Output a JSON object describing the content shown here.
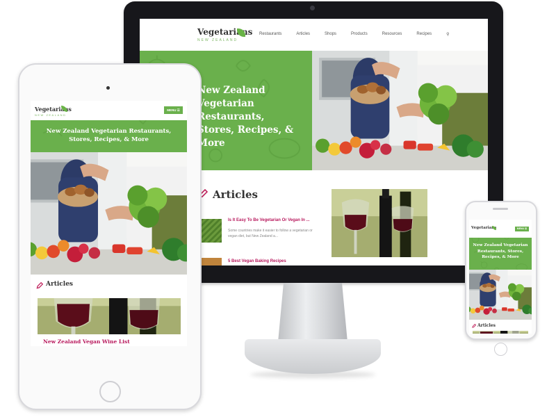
{
  "site": {
    "logo_name": "Vegetarians",
    "logo_sub": "NEW ZEALAND",
    "nav": [
      "Restaurants",
      "Articles",
      "Shops",
      "Products",
      "Resources",
      "Recipes"
    ],
    "menu_button": "MENU ☰"
  },
  "desktop": {
    "hero_title": "New Zealand Vegetarian Restaurants, Stores, Recipes, & More",
    "articles_heading": "Articles",
    "posts": [
      {
        "title": "Is It Easy To Be Vegetarian Or Vegan In ...",
        "excerpt": "Some countries make it easier to follow a vegetarian or vegan diet, but New Zealand a..."
      },
      {
        "title": "5 Best Vegan Baking Recipes",
        "excerpt": ""
      }
    ]
  },
  "tablet": {
    "hero_title": "New Zealand Vegetarian Restaurants, Stores, Recipes, & More",
    "articles_heading": "Articles",
    "post_title": "New Zealand Vegan Wine List"
  },
  "phone": {
    "hero_title": "New Zealand Vegetarian Restaurants, Stores, Recipes, & More",
    "articles_heading": "Articles"
  },
  "colors": {
    "brand_green": "#6ab04c",
    "accent_magenta": "#b8195d",
    "device_bezel": "#17171b"
  }
}
